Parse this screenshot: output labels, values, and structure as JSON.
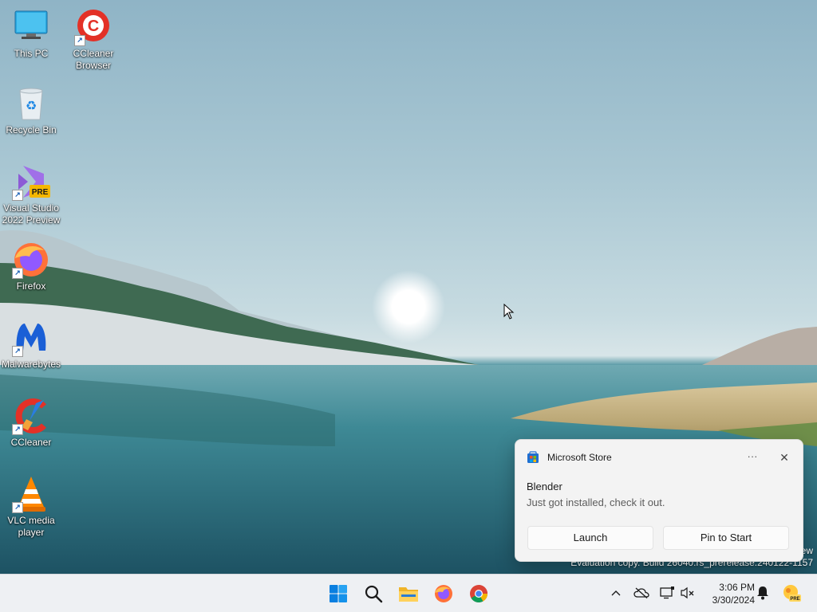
{
  "desktop": {
    "icons": [
      {
        "label": "This PC",
        "icon": "this-pc-icon",
        "shortcut": false
      },
      {
        "label": "CCleaner Browser",
        "icon": "ccleaner-browser-icon",
        "shortcut": true
      },
      {
        "label": "Recycle Bin",
        "icon": "recycle-bin-icon",
        "shortcut": false
      },
      {
        "label": "Visual Studio 2022 Preview",
        "icon": "visual-studio-icon",
        "shortcut": true,
        "badge": "PRE"
      },
      {
        "label": "Firefox",
        "icon": "firefox-icon",
        "shortcut": true
      },
      {
        "label": "Malwarebytes",
        "icon": "malwarebytes-icon",
        "shortcut": true
      },
      {
        "label": "CCleaner",
        "icon": "ccleaner-icon",
        "shortcut": true
      },
      {
        "label": "VLC media player",
        "icon": "vlc-icon",
        "shortcut": true
      }
    ],
    "watermark": {
      "line1": "ew",
      "line2": "Evaluation copy. Build 26040.rs_prerelease.240122-1157"
    }
  },
  "toast": {
    "app_name": "Microsoft Store",
    "more_label": "···",
    "close_label": "✕",
    "title": "Blender",
    "body": "Just got installed, check it out.",
    "buttons": [
      "Launch",
      "Pin to Start"
    ]
  },
  "taskbar": {
    "apps": [
      "start-icon",
      "search-icon",
      "file-explorer-icon",
      "firefox-icon",
      "chrome-icon"
    ],
    "tray": {
      "chevron": "^",
      "time": "3:06 PM",
      "date": "3/30/2024",
      "pre_badge": "PRE"
    }
  },
  "colors": {
    "accent": "#0067c0",
    "taskbar_bg": "#eef0f3",
    "toast_bg": "#f3f3f3"
  }
}
